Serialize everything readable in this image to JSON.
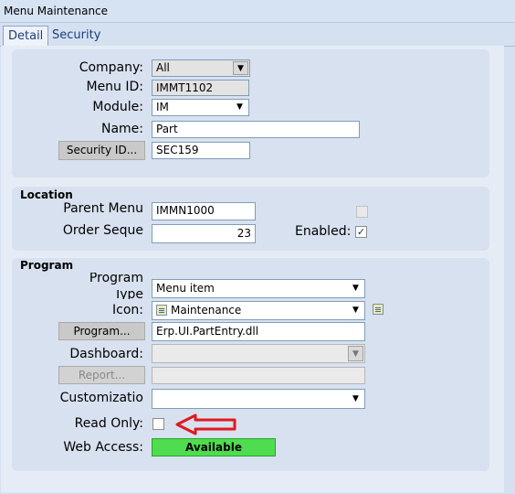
{
  "window": {
    "title": "Menu Maintenance"
  },
  "tabs": [
    {
      "label": "Detail"
    },
    {
      "label": "Security"
    }
  ],
  "detail": {
    "company_label": "Company:",
    "company_value": "All",
    "menu_id_label": "Menu ID:",
    "menu_id_value": "IMMT1102",
    "module_label": "Module:",
    "module_value": "IM",
    "name_label": "Name:",
    "name_value": "Part",
    "security_id_button": "Security ID...",
    "security_id_value": "SEC159"
  },
  "location": {
    "title": "Location",
    "parent_menu_label": "Parent Menu",
    "parent_menu_value": "IMMN1000",
    "order_seq_label": "Order Seque",
    "order_seq_value": "23",
    "enabled_label": "Enabled:",
    "enabled_checked": true
  },
  "program": {
    "title": "Program",
    "program_type_label_1": "Program",
    "program_type_label_2": "Type",
    "program_type_value": "Menu item",
    "icon_label": "Icon:",
    "icon_value": "Maintenance",
    "program_button": "Program...",
    "program_value": "Erp.UI.PartEntry.dll",
    "dashboard_label": "Dashboard:",
    "dashboard_value": "",
    "report_button": "Report...",
    "report_value": "",
    "customization_label": "Customizatio",
    "customization_value": "",
    "read_only_label": "Read Only:",
    "read_only_checked": false,
    "web_access_label": "Web Access:",
    "web_access_value": "Available"
  },
  "colors": {
    "web_access_badge": "#4fdc4f",
    "annotation_arrow": "#e0191f"
  },
  "icons": {
    "dropdown": "chevron-down-icon",
    "menu_icon": "maintenance-icon",
    "annotation": "red-arrow-icon"
  }
}
